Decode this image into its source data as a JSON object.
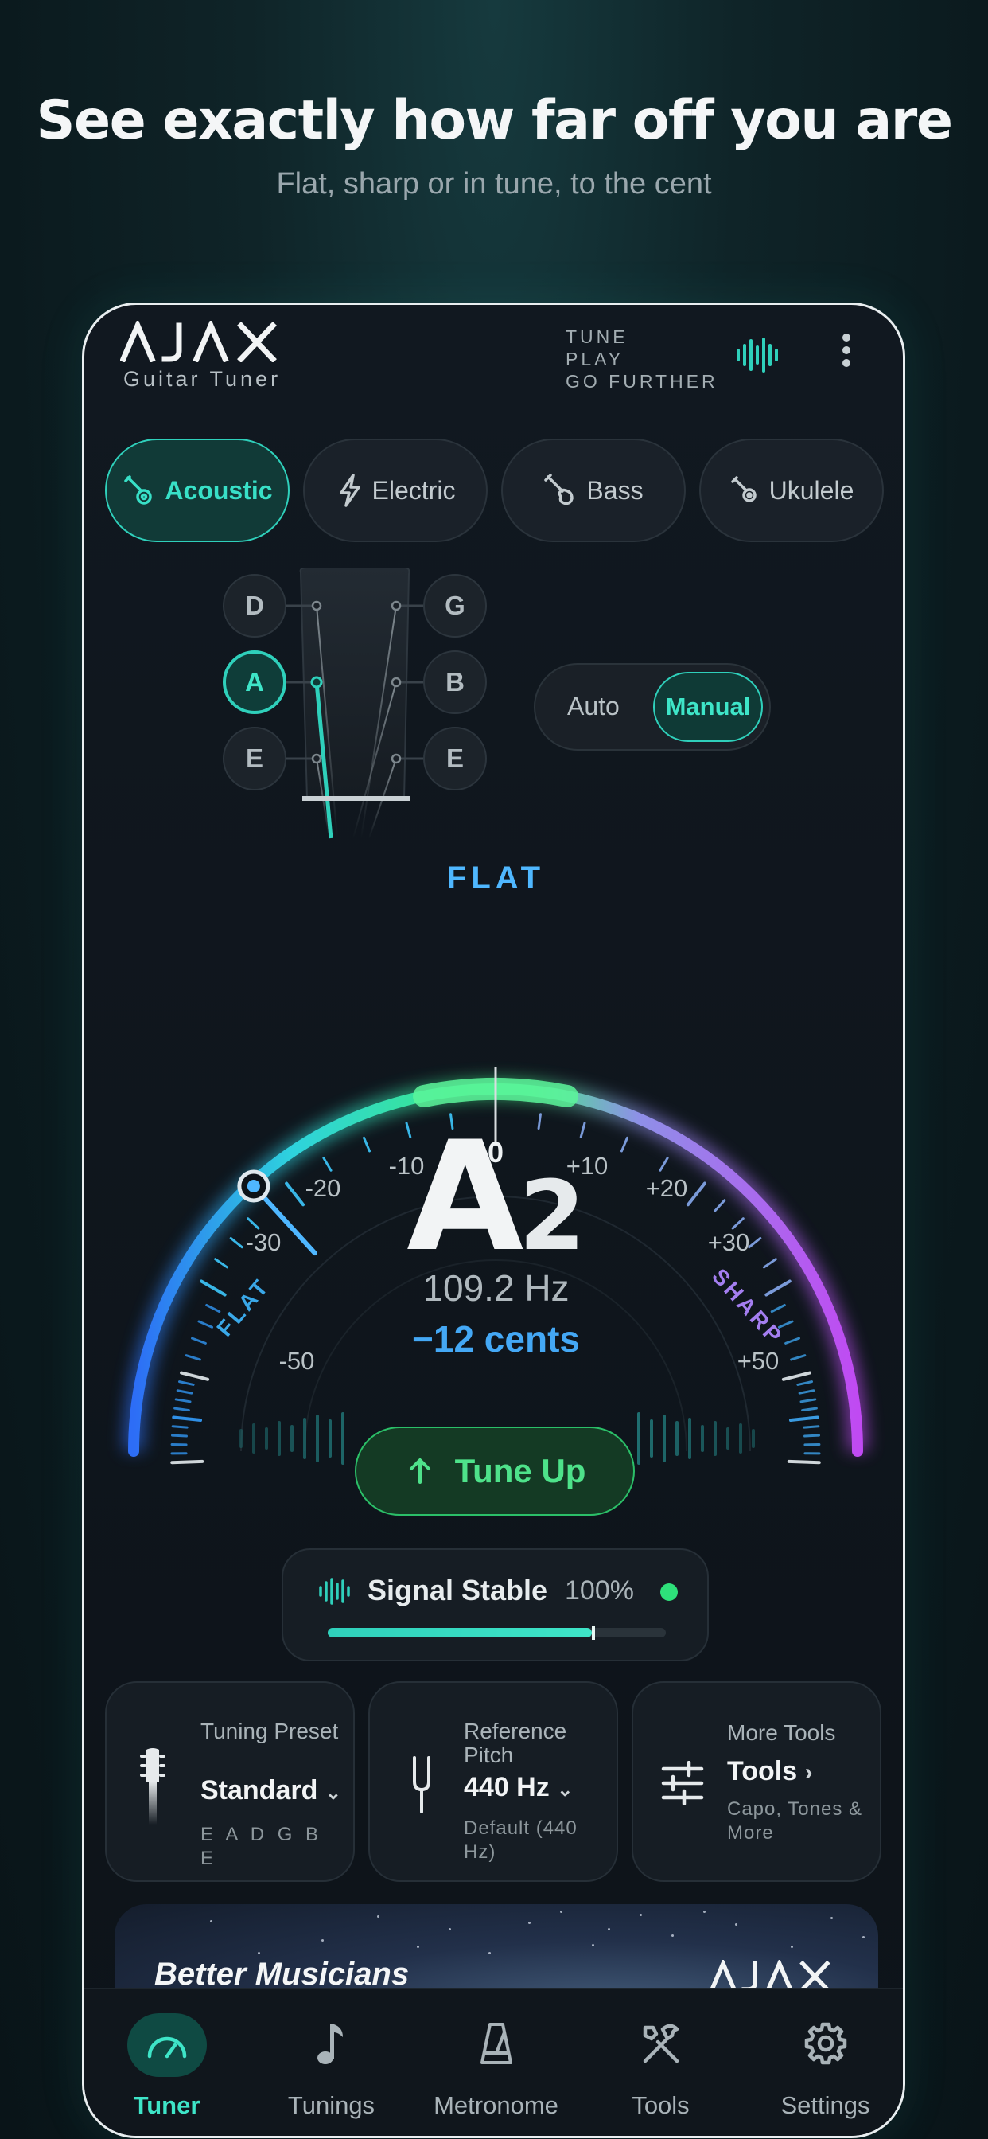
{
  "promo": {
    "headline": "See exactly how far off you are",
    "subheadline": "Flat, sharp or in tune, to the cent"
  },
  "app": {
    "logo_text": "AJAX",
    "logo_subtitle": "Guitar Tuner",
    "slogan": [
      "TUNE",
      "PLAY",
      "GO FURTHER"
    ]
  },
  "instrument_tabs": [
    {
      "label": "Acoustic",
      "active": true,
      "icon": "acoustic-guitar-icon"
    },
    {
      "label": "Electric",
      "active": false,
      "icon": "lightning-icon"
    },
    {
      "label": "Bass",
      "active": false,
      "icon": "bass-guitar-icon"
    },
    {
      "label": "Ukulele",
      "active": false,
      "icon": "ukulele-icon"
    }
  ],
  "headstock": {
    "left_pegs": [
      "D",
      "A",
      "E"
    ],
    "right_pegs": [
      "G",
      "B",
      "E"
    ],
    "active_peg": "A"
  },
  "mode": {
    "auto_label": "Auto",
    "manual_label": "Manual",
    "selected": "Manual"
  },
  "gauge": {
    "status": "FLAT",
    "flat_label": "FLAT",
    "sharp_label": "SHARP",
    "scale_labels": [
      "-50",
      "-30",
      "-20",
      "-10",
      "0",
      "+10",
      "+20",
      "+30",
      "+50"
    ],
    "scale_values": [
      -50,
      -30,
      -20,
      -10,
      0,
      10,
      20,
      30,
      50
    ],
    "needle_cents": -12
  },
  "reading": {
    "note": "A",
    "octave": "2",
    "frequency": "109.2 Hz",
    "cents": "−12 cents"
  },
  "tune_button": {
    "label": "Tune Up",
    "icon": "arrow-up-icon"
  },
  "signal": {
    "label": "Signal Stable",
    "percent_text": "100%",
    "level": 0.78,
    "status_color": "#2ee07a"
  },
  "cards": {
    "preset": {
      "title": "Tuning Preset",
      "value": "Standard",
      "sub": "E A D G B E",
      "icon": "guitar-headstock-icon"
    },
    "pitch": {
      "title": "Reference Pitch",
      "value": "440 Hz",
      "sub": "Default (440 Hz)",
      "icon": "tuning-fork-icon"
    },
    "tools": {
      "title": "More Tools",
      "value": "Tools",
      "sub": "Capo, Tones & More",
      "icon": "sliders-icon"
    }
  },
  "banner": {
    "text": "Better Musicians",
    "logo_text": "AJAX"
  },
  "tabbar": [
    {
      "label": "Tuner",
      "active": true,
      "icon": "gauge-icon"
    },
    {
      "label": "Tunings",
      "active": false,
      "icon": "music-note-icon"
    },
    {
      "label": "Metronome",
      "active": false,
      "icon": "metronome-icon"
    },
    {
      "label": "Tools",
      "active": false,
      "icon": "tools-icon"
    },
    {
      "label": "Settings",
      "active": false,
      "icon": "gear-icon"
    }
  ],
  "colors": {
    "accent_teal": "#2fd0bb",
    "flat_blue": "#44a8f5",
    "sharp_purple": "#b25cf5",
    "in_tune_green": "#2ee07a"
  }
}
